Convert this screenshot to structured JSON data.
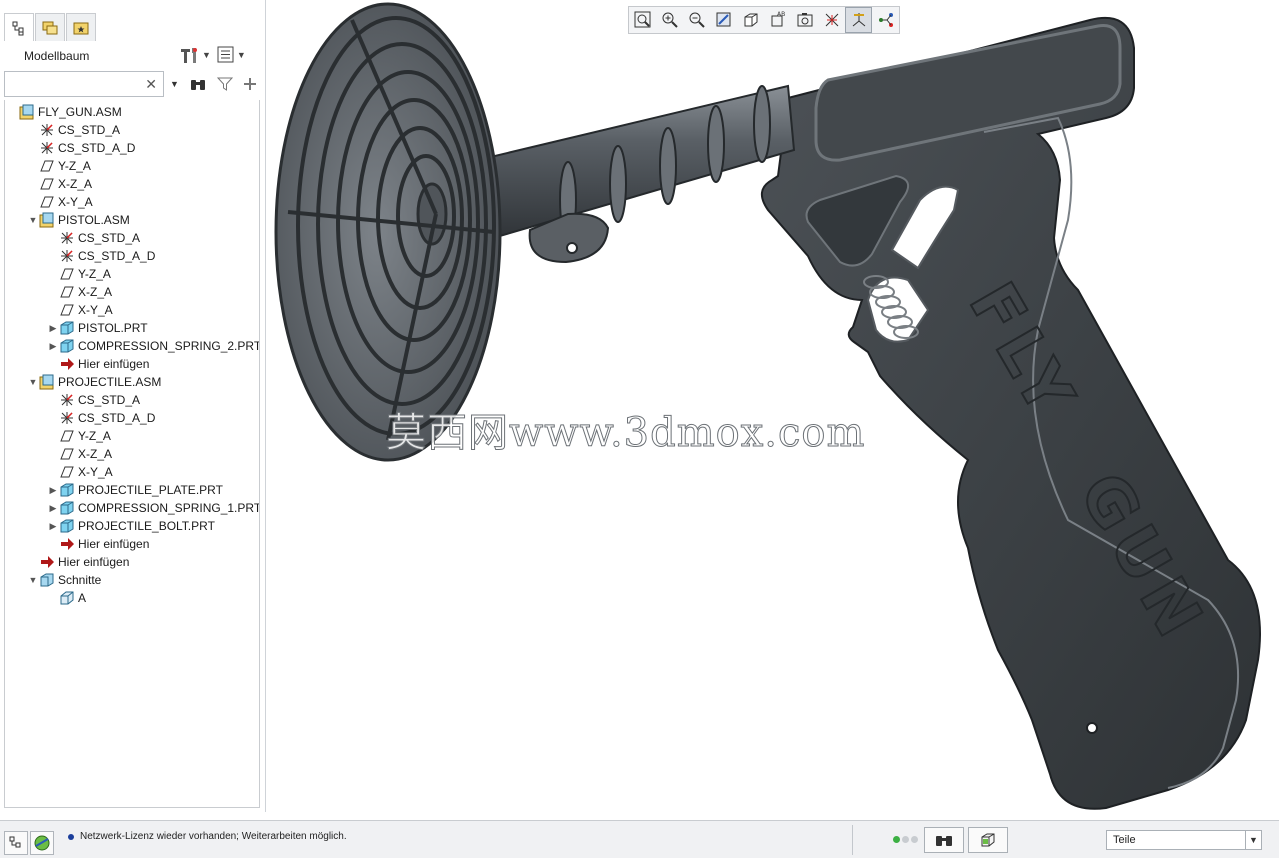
{
  "panel": {
    "title": "Modellbaum",
    "search": {
      "value": "",
      "placeholder": ""
    },
    "tabs": [
      "model-tree-tab",
      "layers-tab",
      "favorites-tab"
    ]
  },
  "tree": [
    {
      "label": "FLY_GUN.ASM",
      "icon": "assembly-icon",
      "level": 0,
      "toggle": ""
    },
    {
      "label": "CS_STD_A",
      "icon": "csys-icon",
      "level": 1,
      "toggle": ""
    },
    {
      "label": "CS_STD_A_D",
      "icon": "csys-icon",
      "level": 1,
      "toggle": ""
    },
    {
      "label": "Y-Z_A",
      "icon": "datum-plane-icon",
      "level": 1,
      "toggle": ""
    },
    {
      "label": "X-Z_A",
      "icon": "datum-plane-icon",
      "level": 1,
      "toggle": ""
    },
    {
      "label": "X-Y_A",
      "icon": "datum-plane-icon",
      "level": 1,
      "toggle": ""
    },
    {
      "label": "PISTOL.ASM",
      "icon": "assembly-icon",
      "level": 1,
      "toggle": "expanded"
    },
    {
      "label": "CS_STD_A",
      "icon": "csys-icon",
      "level": 2,
      "toggle": ""
    },
    {
      "label": "CS_STD_A_D",
      "icon": "csys-icon",
      "level": 2,
      "toggle": ""
    },
    {
      "label": "Y-Z_A",
      "icon": "datum-plane-icon",
      "level": 2,
      "toggle": ""
    },
    {
      "label": "X-Z_A",
      "icon": "datum-plane-icon",
      "level": 2,
      "toggle": ""
    },
    {
      "label": "X-Y_A",
      "icon": "datum-plane-icon",
      "level": 2,
      "toggle": ""
    },
    {
      "label": "PISTOL.PRT",
      "icon": "part-icon",
      "level": 2,
      "toggle": "collapsed"
    },
    {
      "label": "COMPRESSION_SPRING_2.PRT",
      "icon": "part-icon",
      "level": 2,
      "toggle": "collapsed"
    },
    {
      "label": "Hier einfügen",
      "icon": "insert-here-icon",
      "level": 2,
      "toggle": ""
    },
    {
      "label": "PROJECTILE.ASM",
      "icon": "assembly-icon",
      "level": 1,
      "toggle": "expanded"
    },
    {
      "label": "CS_STD_A",
      "icon": "csys-icon",
      "level": 2,
      "toggle": ""
    },
    {
      "label": "CS_STD_A_D",
      "icon": "csys-icon",
      "level": 2,
      "toggle": ""
    },
    {
      "label": "Y-Z_A",
      "icon": "datum-plane-icon",
      "level": 2,
      "toggle": ""
    },
    {
      "label": "X-Z_A",
      "icon": "datum-plane-icon",
      "level": 2,
      "toggle": ""
    },
    {
      "label": "X-Y_A",
      "icon": "datum-plane-icon",
      "level": 2,
      "toggle": ""
    },
    {
      "label": "PROJECTILE_PLATE.PRT",
      "icon": "part-icon",
      "level": 2,
      "toggle": "collapsed"
    },
    {
      "label": "COMPRESSION_SPRING_1.PRT",
      "icon": "part-icon",
      "level": 2,
      "toggle": "collapsed"
    },
    {
      "label": "PROJECTILE_BOLT.PRT",
      "icon": "part-icon",
      "level": 2,
      "toggle": "collapsed"
    },
    {
      "label": "Hier einfügen",
      "icon": "insert-here-icon",
      "level": 2,
      "toggle": ""
    },
    {
      "label": "Hier einfügen",
      "icon": "insert-here-icon",
      "level": 1,
      "toggle": ""
    },
    {
      "label": "Schnitte",
      "icon": "sections-icon",
      "level": 1,
      "toggle": "expanded"
    },
    {
      "label": "A",
      "icon": "section-icon",
      "level": 2,
      "toggle": ""
    }
  ],
  "view_toolbar": [
    "refit-icon",
    "zoom-in-icon",
    "zoom-out-icon",
    "repaint-icon",
    "display-style-icon",
    "saved-orientations-icon",
    "view-manager-icon",
    "perspective-icon",
    "datum-display-icon",
    "annotation-display-icon",
    "spin-center-icon"
  ],
  "viewport": {
    "watermark": "莫西网www.3dmox.com",
    "grip_text_1": "FLY",
    "grip_text_2": "GUN"
  },
  "status": {
    "message": "Netzwerk-Lizenz wieder vorhanden; Weiterarbeiten möglich.",
    "filter_value": "Teile",
    "colors": {
      "message_dot": "#1b3e9b",
      "light_active": "#3cb043",
      "light_idle": "#c8ccd0"
    }
  }
}
